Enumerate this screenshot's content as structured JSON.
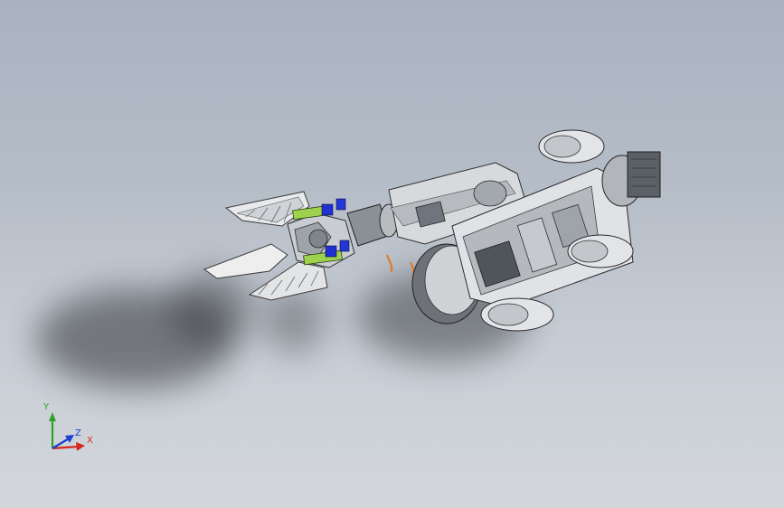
{
  "viewport": {
    "background_top": "#a9b3c0",
    "background_bottom": "#d3d7dc"
  },
  "model": {
    "kind": "robot-arm-gripper-assembly"
  },
  "triad": {
    "x_label": "X",
    "y_label": "Y",
    "z_label": "Z",
    "x_color": "#d42a1e",
    "y_color": "#2fa12a",
    "z_color": "#1c3fd0"
  }
}
